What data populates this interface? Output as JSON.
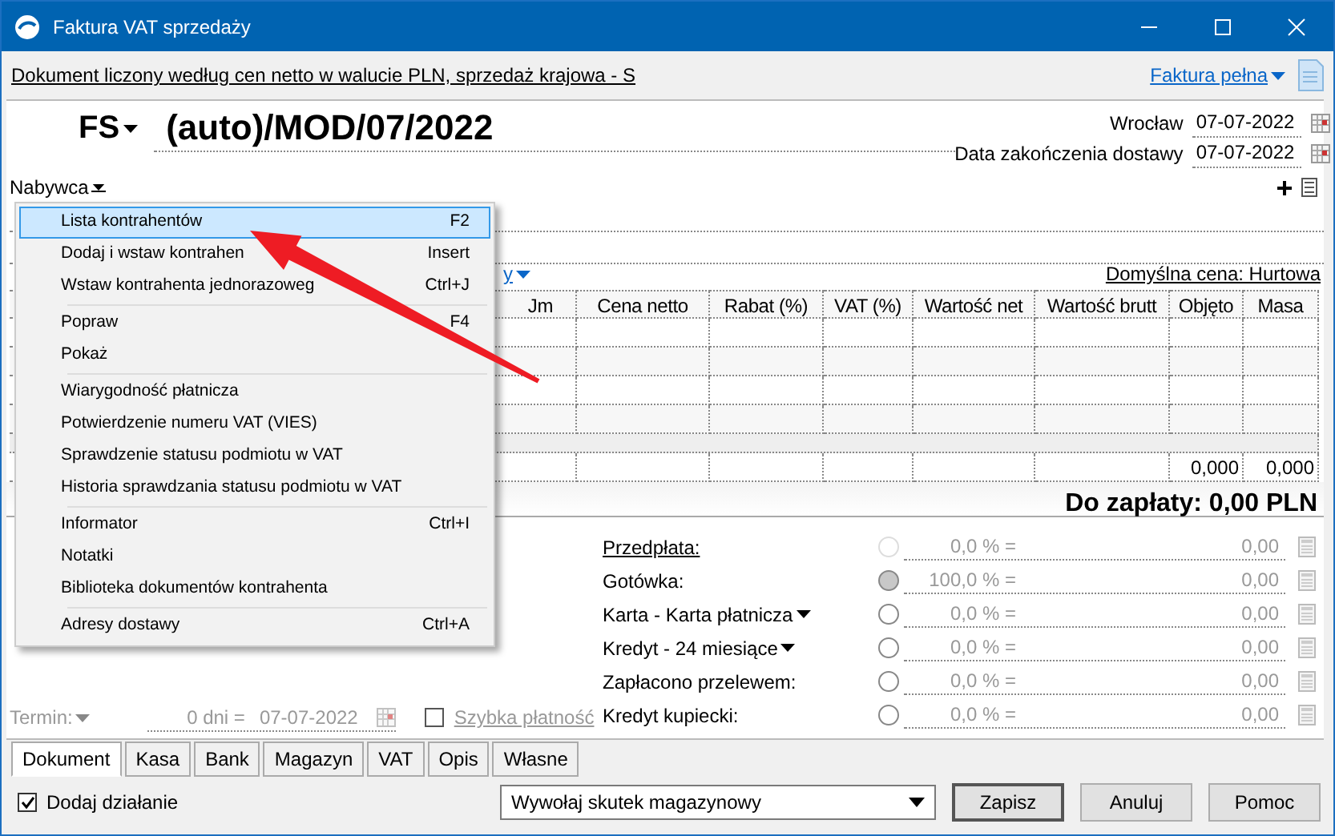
{
  "window": {
    "title": "Faktura VAT sprzedaży"
  },
  "info_bar": {
    "text": "Dokument liczony według cen netto w walucie PLN, sprzedaż krajowa - S",
    "link": "Faktura pełna"
  },
  "document": {
    "type": "FS",
    "number": "(auto)/MOD/07/2022",
    "place": "Wrocław",
    "date": "07-07-2022",
    "delivery_label": "Data zakończenia dostawy",
    "delivery_date": "07-07-2022"
  },
  "buyer_label": "Nabywca",
  "price_link": "y",
  "default_price": "Domyślna cena: Hurtowa",
  "table": {
    "columns": [
      "Jm",
      "Cena netto",
      "Rabat (%)",
      "VAT (%)",
      "Wartość net",
      "Wartość brutt",
      "Objęto",
      "Masa"
    ],
    "totals": {
      "volume": "0,000",
      "mass": "0,000"
    }
  },
  "total": "Do zapłaty: 0,00 PLN",
  "payments": [
    {
      "label": "Przedpłata:",
      "kind": "link",
      "selected": false,
      "disabled": true,
      "percent": "0,0 % =",
      "amount": "0,00"
    },
    {
      "label": "Gotówka:",
      "kind": "plain",
      "selected": true,
      "disabled": false,
      "percent": "100,0 % =",
      "amount": "0,00"
    },
    {
      "label": "Karta - Karta płatnicza",
      "kind": "dropdown",
      "selected": false,
      "disabled": false,
      "percent": "0,0 % =",
      "amount": "0,00"
    },
    {
      "label": "Kredyt - 24 miesiące",
      "kind": "dropdown",
      "selected": false,
      "disabled": false,
      "percent": "0,0 % =",
      "amount": "0,00"
    },
    {
      "label": "Zapłacono przelewem:",
      "kind": "plain",
      "selected": false,
      "disabled": false,
      "percent": "0,0 % =",
      "amount": "0,00"
    },
    {
      "label": "Kredyt kupiecki:",
      "kind": "plain",
      "selected": false,
      "disabled": false,
      "percent": "0,0 % =",
      "amount": "0,00"
    }
  ],
  "term": {
    "label": "Termin:",
    "days": "0 dni =",
    "date": "07-07-2022",
    "quick_pay": {
      "label": "Szybka płatność",
      "checked": false
    }
  },
  "tabs": [
    {
      "label": "Dokument",
      "selected": true
    },
    {
      "label": "Kasa",
      "selected": false
    },
    {
      "label": "Bank",
      "selected": false
    },
    {
      "label": "Magazyn",
      "selected": false
    },
    {
      "label": "VAT",
      "selected": false
    },
    {
      "label": "Opis",
      "selected": false
    },
    {
      "label": "Własne",
      "selected": false
    }
  ],
  "footer": {
    "add_action": {
      "label": "Dodaj działanie",
      "checked": true
    },
    "select": "Wywołaj skutek magazynowy",
    "buttons": [
      {
        "label": "Zapisz",
        "default": true
      },
      {
        "label": "Anuluj",
        "default": false
      },
      {
        "label": "Pomoc",
        "default": false
      }
    ]
  },
  "context_menu": {
    "items": [
      {
        "kind": "item",
        "label": "Lista kontrahentów",
        "shortcut": "F2",
        "selected": true
      },
      {
        "kind": "item",
        "label": "Dodaj i wstaw kontrahen",
        "shortcut": "Insert",
        "selected": false
      },
      {
        "kind": "item",
        "label": "Wstaw kontrahenta jednorazoweg",
        "shortcut": "Ctrl+J",
        "selected": false
      },
      {
        "kind": "separator"
      },
      {
        "kind": "item",
        "label": "Popraw",
        "shortcut": "F4",
        "selected": false
      },
      {
        "kind": "item",
        "label": "Pokaż",
        "selected": false
      },
      {
        "kind": "separator"
      },
      {
        "kind": "item",
        "label": "Wiarygodność płatnicza",
        "selected": false
      },
      {
        "kind": "item",
        "label": "Potwierdzenie numeru VAT (VIES)",
        "selected": false
      },
      {
        "kind": "item",
        "label": "Sprawdzenie statusu podmiotu w VAT",
        "selected": false
      },
      {
        "kind": "item",
        "label": "Historia sprawdzania statusu podmiotu w VAT",
        "selected": false
      },
      {
        "kind": "separator"
      },
      {
        "kind": "item",
        "label": "Informator",
        "shortcut": "Ctrl+I",
        "selected": false
      },
      {
        "kind": "item",
        "label": "Notatki",
        "selected": false
      },
      {
        "kind": "item",
        "label": "Biblioteka dokumentów kontrahenta",
        "selected": false
      },
      {
        "kind": "separator"
      },
      {
        "kind": "item",
        "label": "Adresy dostawy",
        "shortcut": "Ctrl+A",
        "selected": false
      }
    ]
  }
}
